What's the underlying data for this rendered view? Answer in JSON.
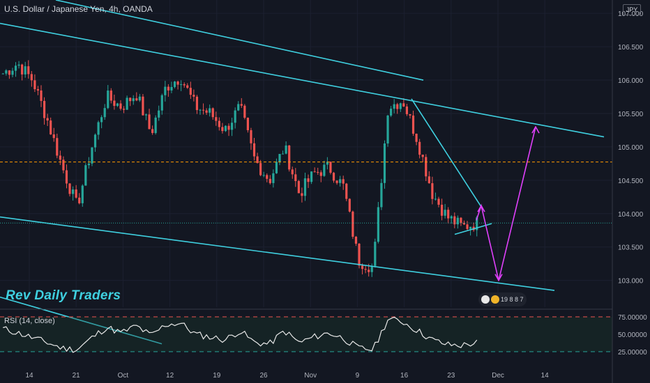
{
  "header": {
    "title": "U.S. Dollar / Japanese Yen, 4h, OANDA"
  },
  "currency_badge": "JPY",
  "watermark": "Rev Daily Traders",
  "events_badge": {
    "text": "19 8 8 7"
  },
  "rsi": {
    "label": "RSI (14, close)",
    "ticks": [
      "75.00000",
      "50.00000",
      "25.00000"
    ],
    "values": [
      75,
      50,
      25
    ]
  },
  "price_axis": {
    "ticks": [
      "107.000",
      "106.500",
      "106.000",
      "105.500",
      "105.000",
      "104.500",
      "104.000",
      "103.500",
      "103.000"
    ]
  },
  "time_axis": {
    "labels": [
      "14",
      "21",
      "Oct",
      "12",
      "19",
      "26",
      "Nov",
      "9",
      "16",
      "23",
      "Dec",
      "14"
    ]
  },
  "markers": {
    "resistance": {
      "value": "104.773",
      "color": "#ff9800"
    },
    "last_price": {
      "value": "103.859",
      "color": "#26a69a"
    }
  },
  "colors": {
    "up": "#26a69a",
    "down": "#ef5350",
    "trendline": "#3fd0e0",
    "projection": "#e040fb",
    "background": "#131722"
  },
  "chart_data": {
    "type": "candlestick",
    "title": "U.S. Dollar / Japanese Yen, 4h, OANDA",
    "ylim": [
      102.6,
      107.2
    ],
    "price_path": [
      106.1,
      106.25,
      106.0,
      105.4,
      104.7,
      104.1,
      105.0,
      105.75,
      105.6,
      105.8,
      105.2,
      105.9,
      106.05,
      105.6,
      105.5,
      105.25,
      105.6,
      104.8,
      104.5,
      105.0,
      104.3,
      104.6,
      104.7,
      104.4,
      103.3,
      103.2,
      105.6,
      105.7,
      105.1,
      104.3,
      103.95,
      103.8,
      103.86
    ],
    "rsi_path": [
      58,
      52,
      45,
      38,
      30,
      28,
      45,
      60,
      52,
      62,
      48,
      64,
      66,
      50,
      46,
      42,
      55,
      38,
      36,
      55,
      38,
      46,
      52,
      44,
      30,
      28,
      72,
      68,
      55,
      42,
      35,
      34,
      38
    ],
    "levels": [
      104.773,
      103.859
    ]
  }
}
